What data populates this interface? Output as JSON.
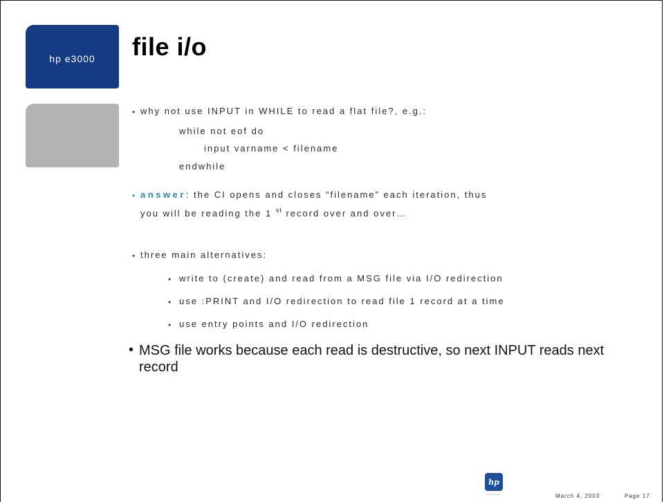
{
  "sidebar": {
    "product_label": "hp e3000"
  },
  "slide": {
    "title": "file i/o",
    "bullets": {
      "q1": "why not use INPUT in WHILE to read a flat file?, e.g.:",
      "code": [
        "while not eof do",
        "input varname  < filename",
        "endwhile"
      ],
      "answer_label": "answer",
      "answer_text_1": ": the CI opens and closes “filename” each iteration, thus",
      "answer_text_2a": "you will be reading the 1 ",
      "answer_sup": "st",
      "answer_text_2b": " record over and over…",
      "alternatives_intro": "three main alternatives:",
      "alternatives": [
        "write to (create) and read from a MSG file via I/O redirection",
        "use :PRINT and I/O redirection to read file 1 record at a time",
        "use entry points and I/O redirection"
      ],
      "msg_note": "MSG file works because each read is destructive, so next INPUT reads next record"
    }
  },
  "footer": {
    "logo_text": "invent",
    "date": "March 4, 2003",
    "page": "Page 17"
  },
  "colors": {
    "product_box": "#163b85",
    "gray_box": "#b3b3b3",
    "accent": "#2a8aa8"
  }
}
